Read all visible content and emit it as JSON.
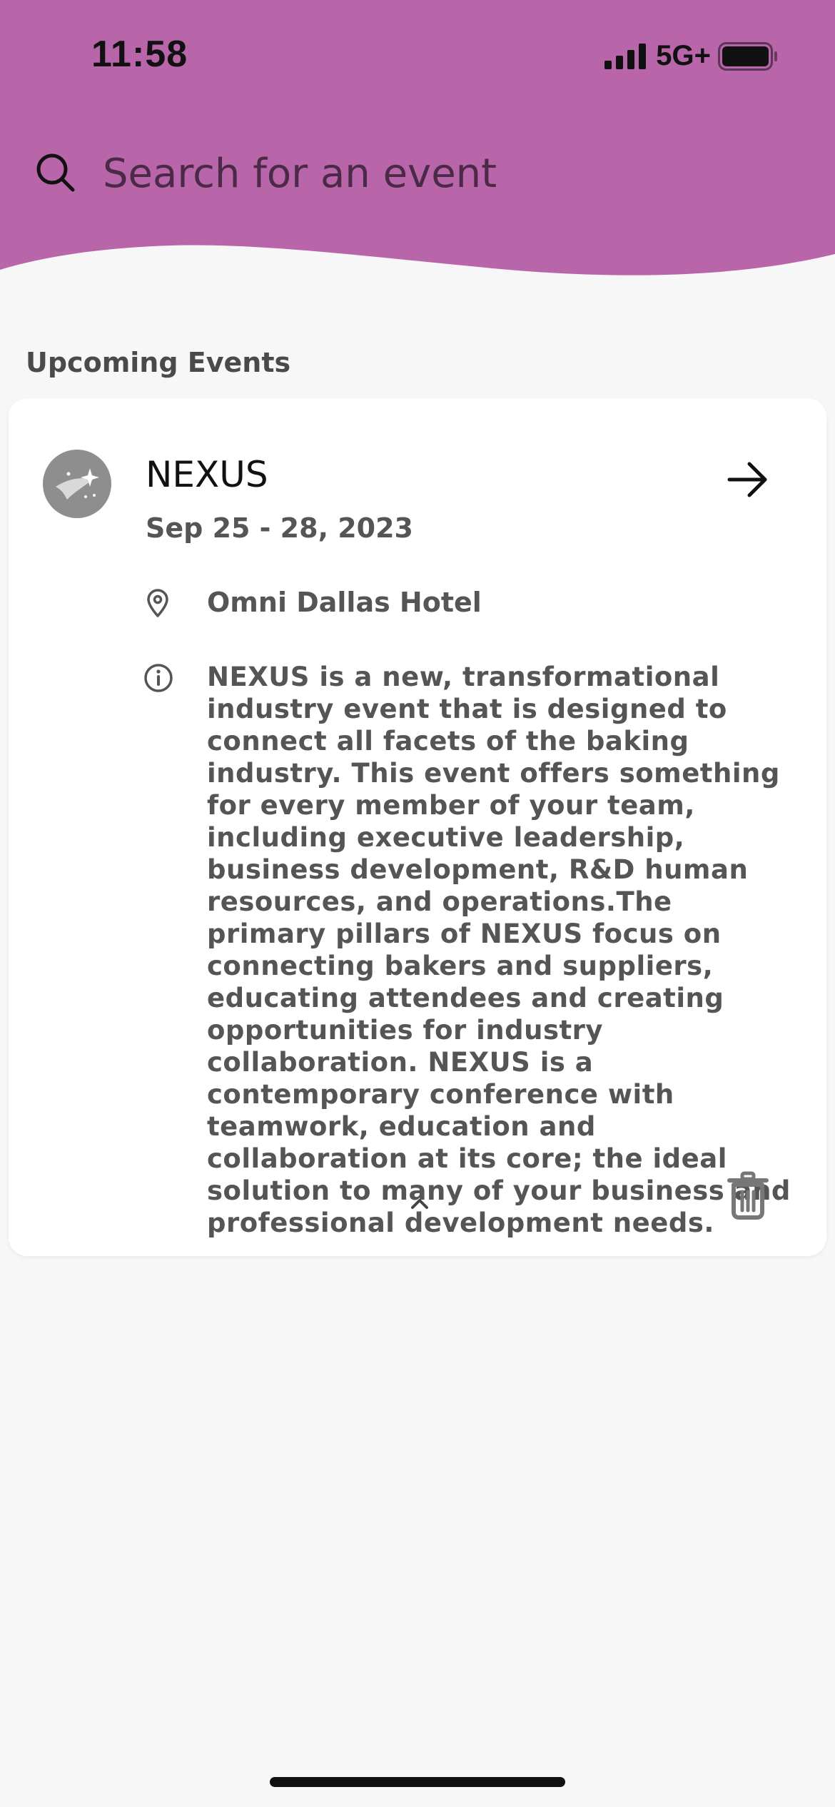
{
  "status_bar": {
    "time": "11:58",
    "network": "5G+"
  },
  "search": {
    "placeholder": "Search for an event",
    "icon": "search-icon"
  },
  "section": {
    "title": "Upcoming Events"
  },
  "event": {
    "title": "NEXUS",
    "date": "Sep 25 - 28, 2023",
    "location": "Omni Dallas Hotel",
    "description": "NEXUS is a new, transformational industry event that is designed to connect all facets of the baking industry. This event offers something for every member of your team, including executive leadership, business development, R&D human resources, and operations.The primary pillars of NEXUS focus on connecting bakers and suppliers, educating attendees and creating opportunities for industry collaboration. NEXUS is a contemporary conference with teamwork, education and collaboration at its core; the ideal solution to many of your business and professional development needs."
  },
  "colors": {
    "header": "#b965aa",
    "background": "#f7f7f7",
    "card": "#ffffff",
    "text_muted": "#555555"
  },
  "icons": {
    "open": "arrow-right-icon",
    "location": "map-pin-icon",
    "info": "info-icon",
    "collapse": "chevron-up-icon",
    "delete": "trash-icon",
    "avatar": "shooting-star-icon"
  }
}
